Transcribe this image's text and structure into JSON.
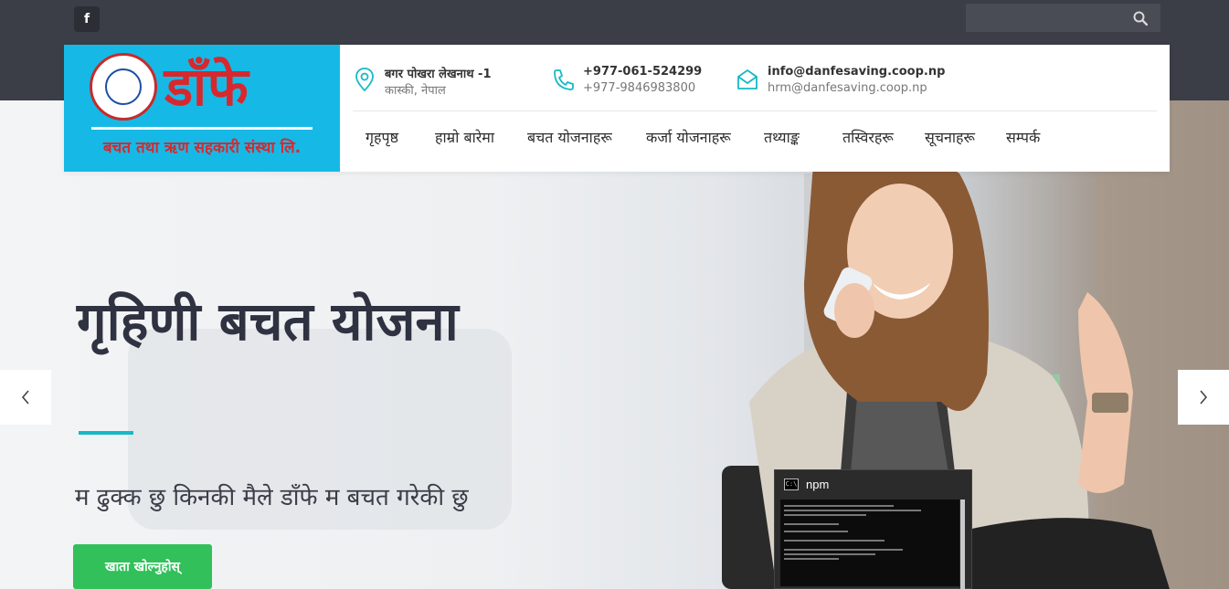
{
  "topbar": {
    "facebook_label": "f",
    "search": {
      "placeholder": "",
      "value": ""
    }
  },
  "header": {
    "logo": {
      "title": "डाँफे",
      "subtitle": "बचत तथा ऋण सहकारी संस्था लि."
    },
    "contacts": [
      {
        "icon": "map-pin-icon",
        "line1": "बगर पोखरा लेखनाथ -1",
        "line2": "कास्की, नेपाल"
      },
      {
        "icon": "phone-icon",
        "line1": "+977-061-524299",
        "line2": "+977-9846983800"
      },
      {
        "icon": "envelope-icon",
        "line1": "info@danfesaving.coop.np",
        "line2": "hrm@danfesaving.coop.np"
      }
    ],
    "nav": [
      {
        "label": "गृहपृष्ठ"
      },
      {
        "label": "हाम्रो बारेमा"
      },
      {
        "label": "बचत योजनाहरू"
      },
      {
        "label": "कर्जा योजनाहरू"
      },
      {
        "label": "तथ्याङ्क"
      },
      {
        "label": "तस्विरहरू"
      },
      {
        "label": "सूचनाहरू"
      },
      {
        "label": "सम्पर्क"
      }
    ]
  },
  "hero": {
    "title": "गृहिणी बचत योजना",
    "tagline": "म ढुक्क छु किनकी मैले डाँफे म बचत गरेकी छु",
    "cta_label": "खाता खोल्नुहोस्"
  },
  "overlay": {
    "window_title": "npm",
    "icon_text": "C:\\"
  },
  "colors": {
    "topbar": "#3b3d47",
    "logo_bg": "#16b9e6",
    "logo_red": "#d7282e",
    "accent": "#16b9c6",
    "cta": "#31c05a",
    "text_dark": "#2f3240"
  }
}
